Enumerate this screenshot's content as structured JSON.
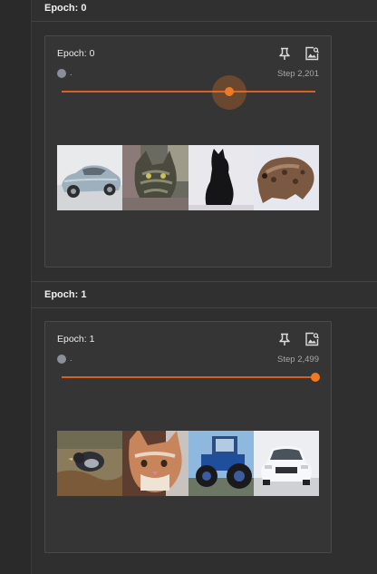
{
  "groups": [
    {
      "header": "Epoch: 0",
      "card": {
        "title": "Epoch: 0",
        "run_label": ".",
        "step_label": "Step 2,201",
        "slider_position": 0.66,
        "slider_active": true,
        "images": [
          "car-silver",
          "cat-tabby",
          "dog-black",
          "toad-brown"
        ]
      }
    },
    {
      "header": "Epoch: 1",
      "card": {
        "title": "Epoch: 1",
        "run_label": ".",
        "step_label": "Step 2,499",
        "slider_position": 1.0,
        "slider_active": false,
        "images": [
          "bird-ground",
          "cat-orange",
          "tractor-blue",
          "car-white"
        ]
      }
    }
  ],
  "colors": {
    "accent": "#f07a22",
    "run_dot": "#8a8f99"
  },
  "icons": {
    "pin": "pin-icon",
    "image_settings": "image-settings-icon"
  }
}
